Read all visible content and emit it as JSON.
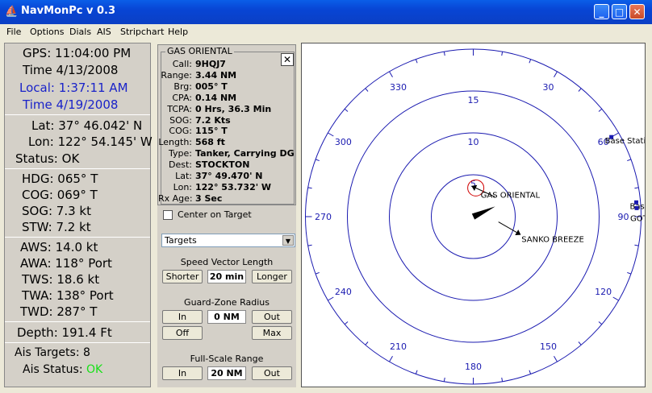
{
  "window": {
    "title": "NavMonPc v 0.3",
    "tooltip": "Cl"
  },
  "menu": [
    "File",
    "Options",
    "Dials",
    "AIS",
    "Stripchart",
    "Help"
  ],
  "nav": {
    "gps_label": "GPS:",
    "gps_value": "11:04:00 PM",
    "time_label": "Time",
    "time_value": "4/13/2008",
    "local_label": "Local:",
    "local_value": "1:37:11 AM",
    "ltime_label": "Time",
    "ltime_value": "4/19/2008",
    "lat_label": "Lat:",
    "lat_value": "37° 46.042' N",
    "lon_label": "Lon:",
    "lon_value": "122° 54.145' W",
    "status_label": "Status:",
    "status_value": "OK",
    "hdg_label": "HDG:",
    "hdg_value": "065° T",
    "cog_label": "COG:",
    "cog_value": "069° T",
    "sog_label": "SOG:",
    "sog_value": "7.3 kt",
    "stw_label": "STW:",
    "stw_value": "7.2 kt",
    "aws_label": "AWS:",
    "aws_value": "14.0 kt",
    "awa_label": "AWA:",
    "awa_value": "118° Port",
    "tws_label": "TWS:",
    "tws_value": "18.6 kt",
    "twa_label": "TWA:",
    "twa_value": "138° Port",
    "twd_label": "TWD:",
    "twd_value": "287° T",
    "depth_label": "Depth:",
    "depth_value": "191.4 Ft",
    "ais_targets_label": "Ais Targets:",
    "ais_targets_value": "8",
    "ais_status_label": "Ais Status:",
    "ais_status_value": "OK"
  },
  "target": {
    "name": "GAS ORIENTAL",
    "close_label": "✕",
    "fields": [
      {
        "k": "Call:",
        "v": "9HQJ7"
      },
      {
        "k": "Range:",
        "v": "3.44 NM"
      },
      {
        "k": "Brg:",
        "v": "005° T"
      },
      {
        "k": "CPA:",
        "v": "0.14 NM"
      },
      {
        "k": "TCPA:",
        "v": "0 Hrs, 36.3 Min"
      },
      {
        "k": "SOG:",
        "v": "7.2 Kts"
      },
      {
        "k": "COG:",
        "v": "115° T"
      },
      {
        "k": "Length:",
        "v": "568 ft"
      },
      {
        "k": "Type:",
        "v": "Tanker, Carrying DG, c"
      },
      {
        "k": "Dest:",
        "v": "STOCKTON"
      },
      {
        "k": "Lat:",
        "v": "37° 49.470' N"
      },
      {
        "k": "Lon:",
        "v": "122° 53.732' W"
      },
      {
        "k": "Rx Age:",
        "v": "3 Sec"
      }
    ]
  },
  "controls": {
    "center_on_target": "Center on Target",
    "dropdown_value": "Targets",
    "speed_vector_label": "Speed Vector Length",
    "shorter": "Shorter",
    "speed_vector_value": "20 min",
    "longer": "Longer",
    "guard_zone_label": "Guard-Zone Radius",
    "gz_in": "In",
    "gz_value": "0 NM",
    "gz_out": "Out",
    "gz_off": "Off",
    "gz_max": "Max",
    "fullscale_label": "Full-Scale Range",
    "fs_in": "In",
    "fs_value": "20 NM",
    "fs_out": "Out"
  },
  "radar": {
    "range_rings": [
      {
        "label": "15",
        "fraction": 0.75
      },
      {
        "label": "10",
        "fraction": 0.5
      },
      {
        "label": "5",
        "fraction": 0.25
      }
    ],
    "bearing_labels": [
      "30",
      "60",
      "90",
      "120",
      "150",
      "180",
      "210",
      "240",
      "270",
      "300",
      "330"
    ],
    "targets": [
      {
        "name": "GAS ORIENTAL",
        "range_nm": 3.44,
        "bearing_deg": 5,
        "cog_deg": 115,
        "selected": true
      },
      {
        "name": "SANKO BREEZE",
        "range_nm": 5.5,
        "bearing_deg": 110,
        "cog_deg": 300
      },
      {
        "name": "Base Station",
        "range_nm": 19.0,
        "bearing_deg": 60
      },
      {
        "name": "Base",
        "range_nm": 19.5,
        "bearing_deg": 85
      },
      {
        "name": "GOTO",
        "range_nm": 19.5,
        "bearing_deg": 87
      }
    ],
    "own_ship": {
      "hdg_deg": 65
    },
    "colors": {
      "ring": "#1a1ab0",
      "label": "#1a1ab0",
      "target": "#000000",
      "selected_ring": "#d00000"
    }
  }
}
